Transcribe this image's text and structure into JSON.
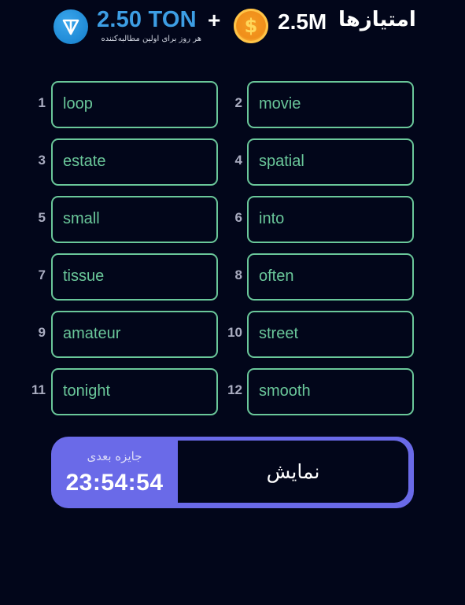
{
  "header": {
    "ton_icon": "ton-logo-icon",
    "ton_amount": "2.50 TON",
    "ton_subtitle": "هر روز برای اولین مطالبه‌کننده",
    "plus": "+",
    "coin_icon": "gold-coin-dollar-icon",
    "coin_symbol": "$",
    "points_amount": "2.5M",
    "points_label": "امتیازها"
  },
  "words": [
    {
      "num": "1",
      "word": "loop"
    },
    {
      "num": "2",
      "word": "movie"
    },
    {
      "num": "3",
      "word": "estate"
    },
    {
      "num": "4",
      "word": "spatial"
    },
    {
      "num": "5",
      "word": "small"
    },
    {
      "num": "6",
      "word": "into"
    },
    {
      "num": "7",
      "word": "tissue"
    },
    {
      "num": "8",
      "word": "often"
    },
    {
      "num": "9",
      "word": "amateur"
    },
    {
      "num": "10",
      "word": "street"
    },
    {
      "num": "11",
      "word": "tonight"
    },
    {
      "num": "12",
      "word": "smooth"
    }
  ],
  "prize": {
    "label": "جایزه بعدی",
    "countdown": "23:54:54",
    "show_button_label": "نمایش"
  },
  "colors": {
    "background": "#02061a",
    "word_accent": "#6ac79a",
    "ton_blue": "#3d9ee4",
    "panel_purple": "#6a6ae8",
    "coin_orange": "#f08f1a"
  }
}
